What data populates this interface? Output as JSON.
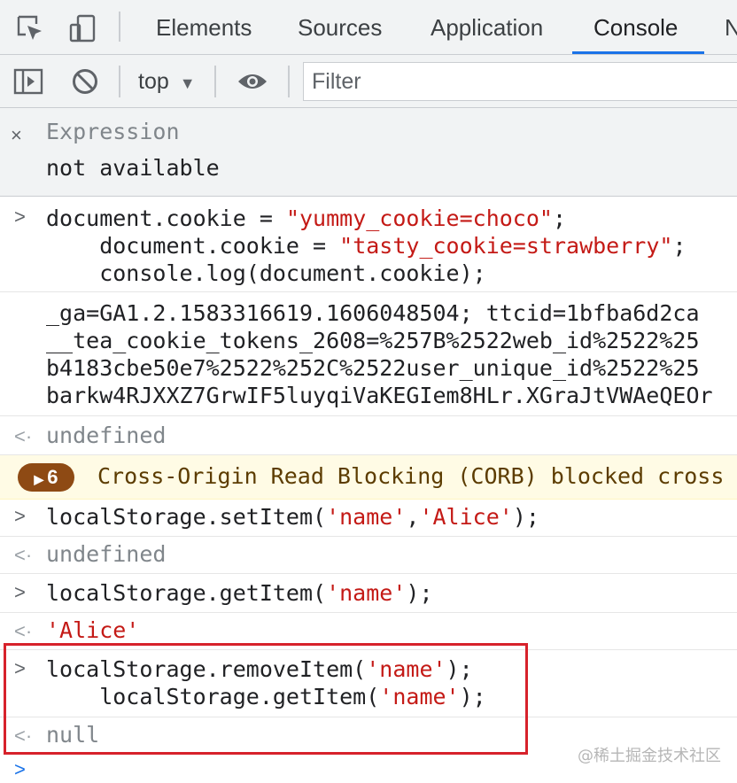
{
  "tabs": [
    {
      "label": "Elements"
    },
    {
      "label": "Sources"
    },
    {
      "label": "Application"
    },
    {
      "label": "Console"
    },
    {
      "label": "N"
    }
  ],
  "active_tab": "Console",
  "toolbar": {
    "context": "top",
    "context_caret": "▼",
    "filter_placeholder": "Filter"
  },
  "expression": {
    "close": "×",
    "title": "Expression",
    "value": "not available"
  },
  "console": {
    "cmd1": {
      "line1_pre": "document.cookie = ",
      "line1_str": "\"yummy_cookie=choco\"",
      "line1_post": ";",
      "line2_pre": "    document.cookie = ",
      "line2_str": "\"tasty_cookie=strawberry\"",
      "line2_post": ";",
      "line3": "    console.log(document.cookie);"
    },
    "log1": [
      "_ga=GA1.2.1583316619.1606048504; ttcid=1bfba6d2ca",
      "__tea_cookie_tokens_2608=%257B%2522web_id%2522%25",
      "b4183cbe50e7%2522%252C%2522user_unique_id%2522%25",
      "barkw4RJXXZ7GrwIF5luyqiVaKEGIem8HLr.XGraJtVWAeQEOr"
    ],
    "result1": "undefined",
    "warning": {
      "count": "6",
      "toggle": "▶",
      "text": "Cross-Origin Read Blocking (CORB) blocked cross"
    },
    "cmd2": {
      "pre": "localStorage.setItem(",
      "a1": "'name'",
      "comma": ",",
      "a2": "'Alice'",
      "post": ");"
    },
    "result2": "undefined",
    "cmd3": {
      "pre": "localStorage.getItem(",
      "a1": "'name'",
      "post": ");"
    },
    "result3": "'Alice'",
    "cmd4": {
      "line1_pre": "localStorage.removeItem(",
      "line1_str": "'name'",
      "line1_post": ");",
      "line2_pre": "    localStorage.getItem(",
      "line2_str": "'name'",
      "line2_post": ");"
    },
    "result4": "null",
    "prompt_caret": ">",
    "output_arrow": "<·"
  },
  "watermark": "@稀土掘金技术社区",
  "colors": {
    "string": "#c41a16",
    "accent": "#1a73e8",
    "highlight_border": "#d7222b",
    "warning_bg": "#fffbe5",
    "warning_pill": "#8e4a14"
  },
  "icons": [
    "inspect-element-icon",
    "device-toolbar-icon",
    "sidebar-toggle-icon",
    "clear-console-icon",
    "eye-icon",
    "close-icon",
    "prompt-caret-icon",
    "output-arrow-icon"
  ]
}
